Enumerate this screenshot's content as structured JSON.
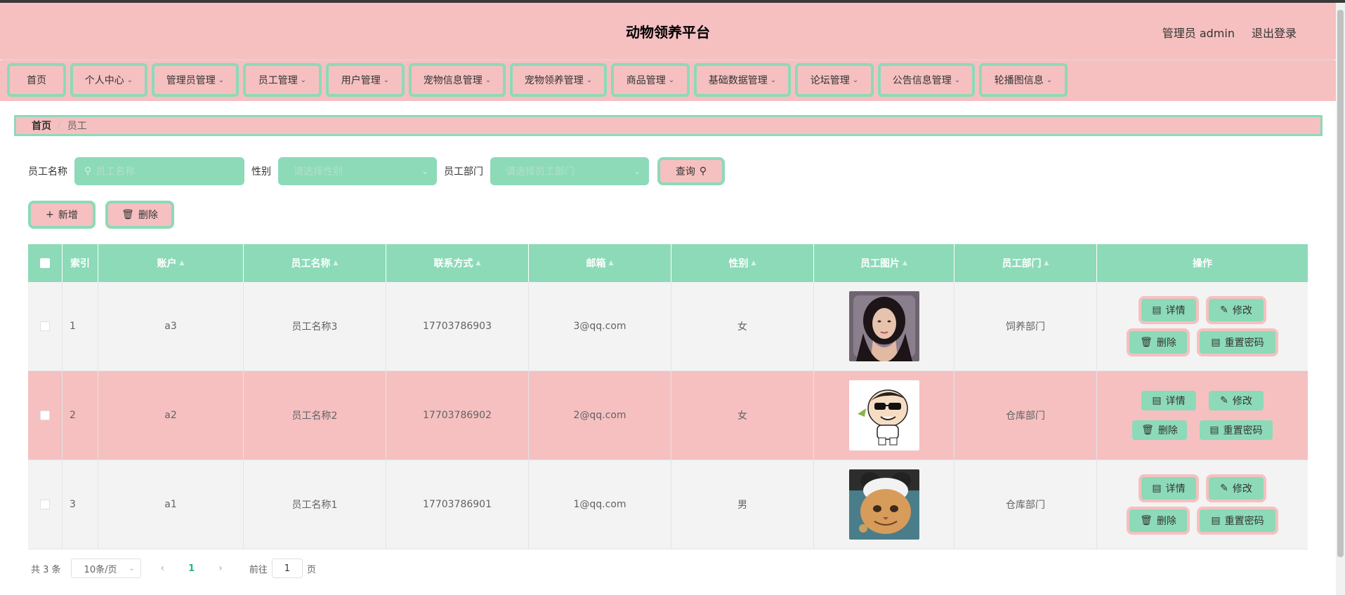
{
  "header": {
    "title": "动物领养平台",
    "user_label": "管理员 admin",
    "logout": "退出登录"
  },
  "nav": [
    {
      "label": "首页",
      "dropdown": false
    },
    {
      "label": "个人中心",
      "dropdown": true
    },
    {
      "label": "管理员管理",
      "dropdown": true
    },
    {
      "label": "员工管理",
      "dropdown": true
    },
    {
      "label": "用户管理",
      "dropdown": true
    },
    {
      "label": "宠物信息管理",
      "dropdown": true
    },
    {
      "label": "宠物领养管理",
      "dropdown": true
    },
    {
      "label": "商品管理",
      "dropdown": true
    },
    {
      "label": "基础数据管理",
      "dropdown": true
    },
    {
      "label": "论坛管理",
      "dropdown": true
    },
    {
      "label": "公告信息管理",
      "dropdown": true
    },
    {
      "label": "轮播图信息",
      "dropdown": true
    }
  ],
  "breadcrumb": {
    "home": "首页",
    "sep": "/",
    "current": "员工"
  },
  "search": {
    "name_label": "员工名称",
    "name_placeholder": "员工名称",
    "gender_label": "性别",
    "gender_placeholder": "请选择性别",
    "dept_label": "员工部门",
    "dept_placeholder": "请选择员工部门",
    "query_button": "查询"
  },
  "actions": {
    "add": "新增",
    "delete": "删除"
  },
  "table": {
    "columns": [
      "索引",
      "账户",
      "员工名称",
      "联系方式",
      "邮箱",
      "性别",
      "员工图片",
      "员工部门",
      "操作"
    ],
    "rows": [
      {
        "index": "1",
        "account": "a3",
        "name": "员工名称3",
        "phone": "17703786903",
        "email": "3@qq.com",
        "gender": "女",
        "image": "woman-portrait",
        "dept": "饲养部门"
      },
      {
        "index": "2",
        "account": "a2",
        "name": "员工名称2",
        "phone": "17703786902",
        "email": "2@qq.com",
        "gender": "女",
        "image": "cartoon-boy",
        "dept": "仓库部门"
      },
      {
        "index": "3",
        "account": "a1",
        "name": "员工名称1",
        "phone": "17703786901",
        "email": "1@qq.com",
        "gender": "男",
        "image": "cat-photo",
        "dept": "仓库部门"
      }
    ],
    "row_actions": {
      "detail": "详情",
      "edit": "修改",
      "delete": "删除",
      "reset": "重置密码"
    }
  },
  "pagination": {
    "total": "共 3 条",
    "page_size": "10条/页",
    "current_page": "1",
    "goto_label": "前往",
    "goto_value": "1",
    "page_suffix": "页"
  },
  "colors": {
    "pink": "#f6c0c0",
    "green": "#8cdab8"
  }
}
